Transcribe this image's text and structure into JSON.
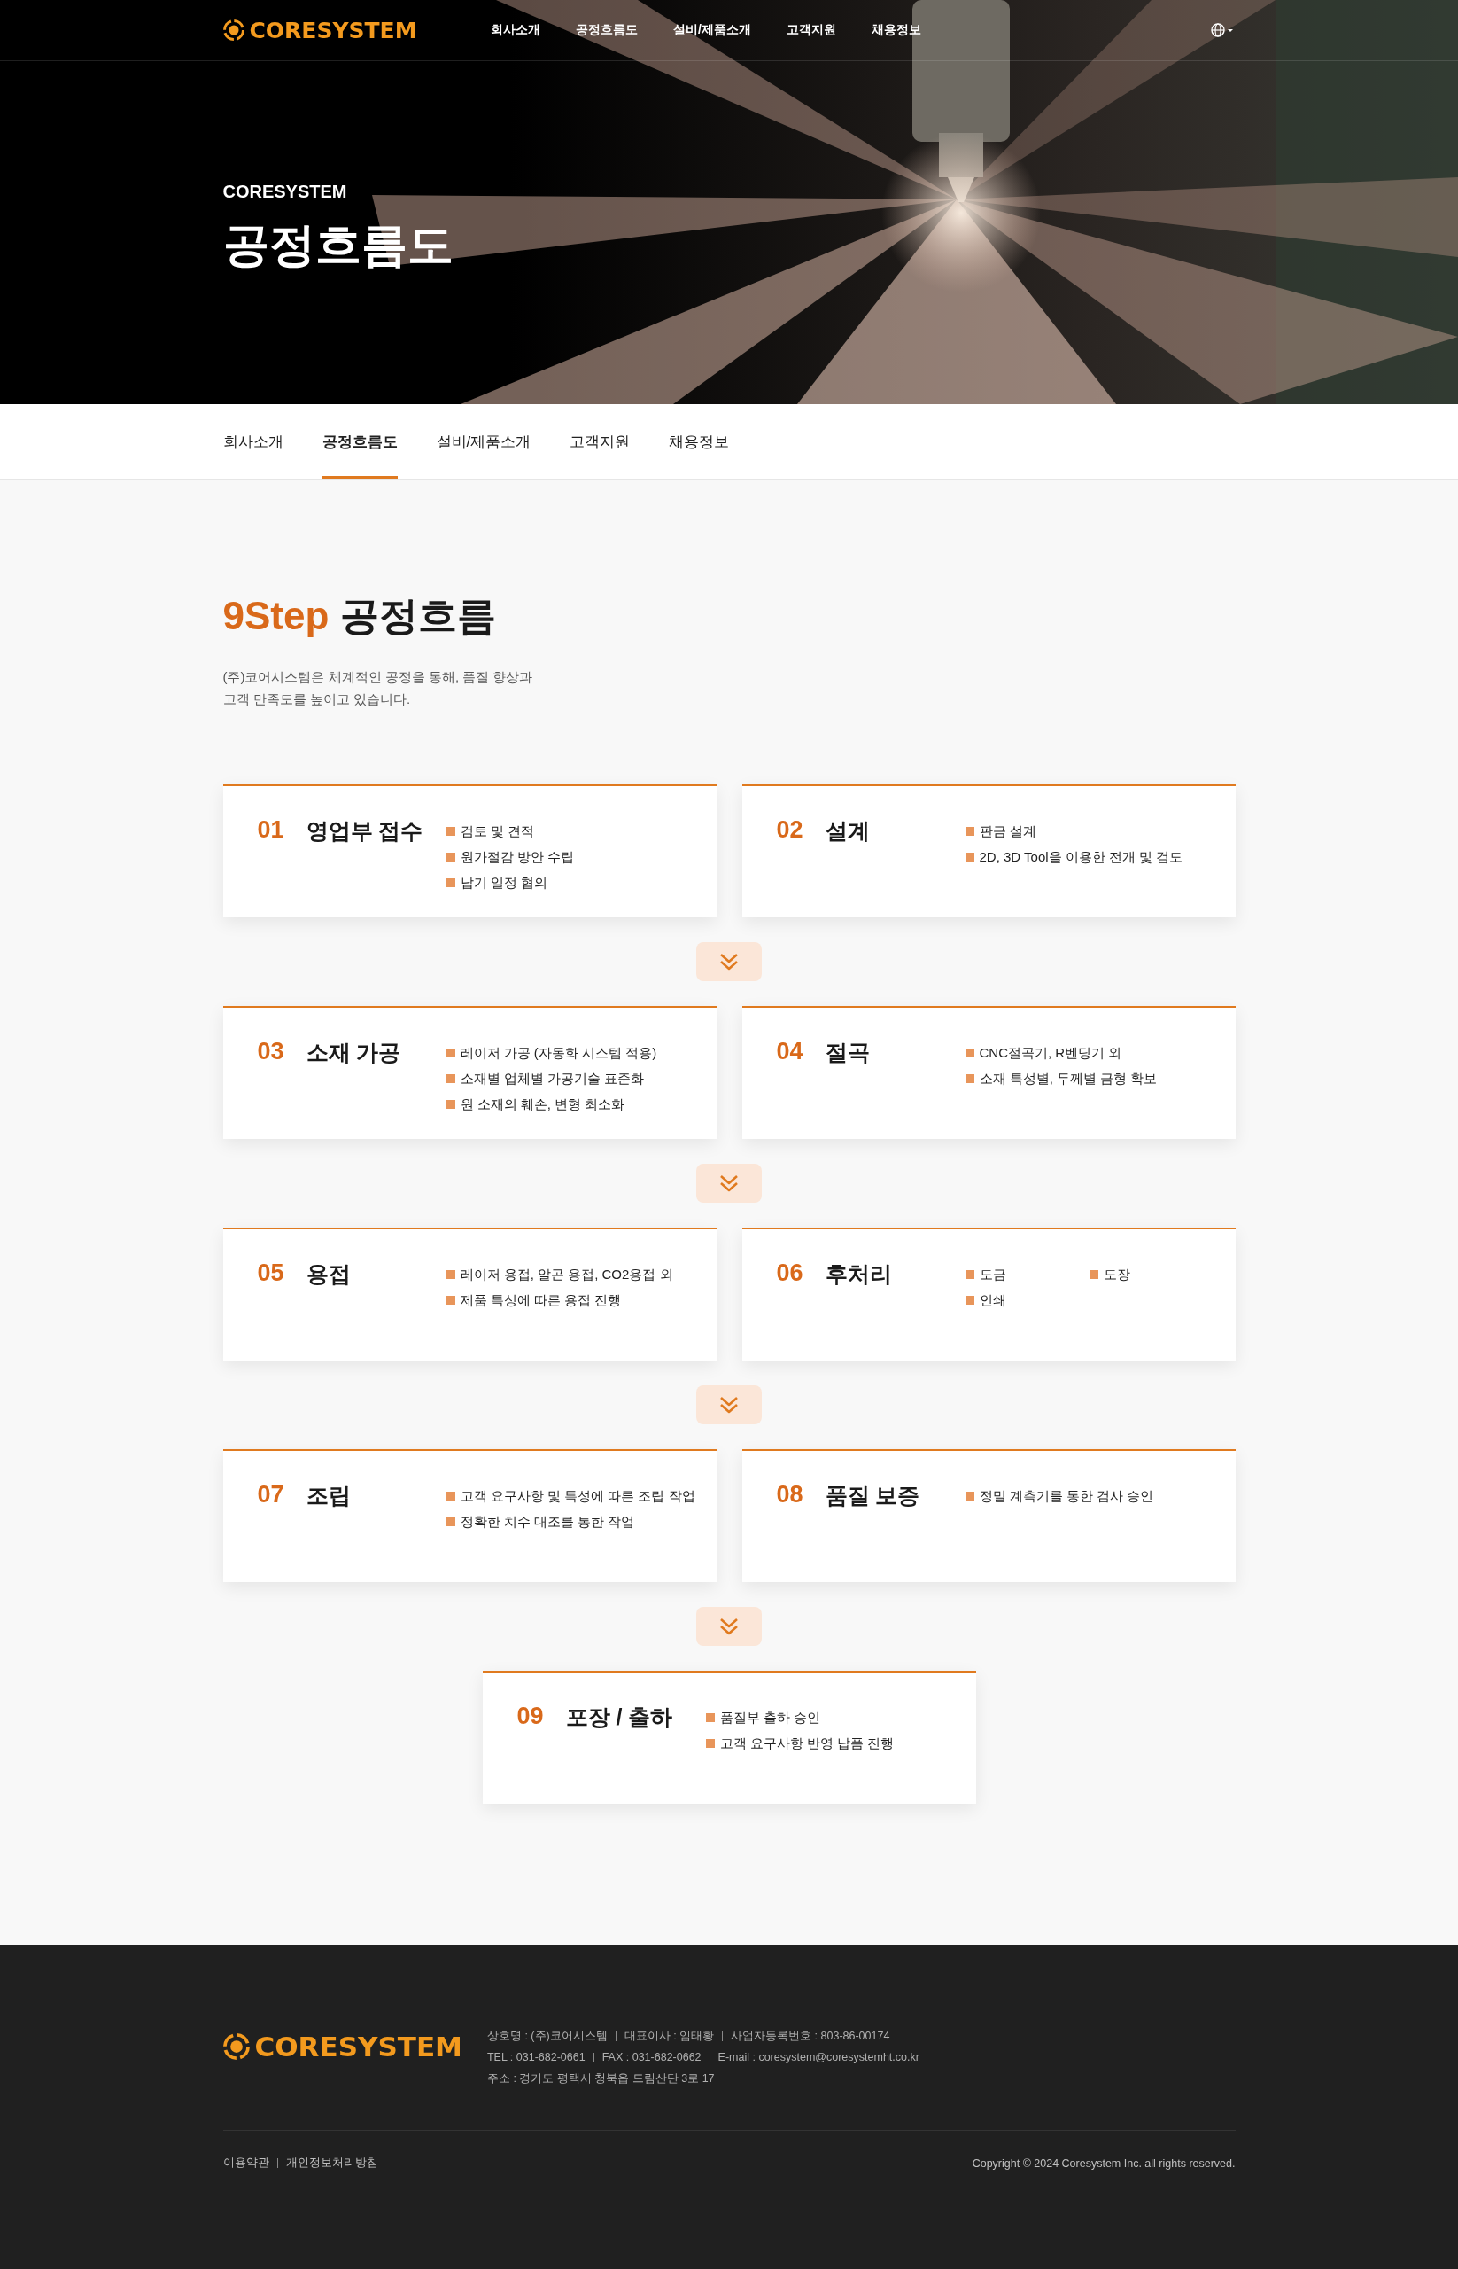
{
  "header": {
    "logo": "CORESYSTEM",
    "nav": [
      "회사소개",
      "공정흐름도",
      "설비/제품소개",
      "고객지원",
      "채용정보"
    ]
  },
  "hero": {
    "subtitle": "CORESYSTEM",
    "title": "공정흐름도"
  },
  "subnav": [
    {
      "label": "회사소개",
      "selected": false
    },
    {
      "label": "공정흐름도",
      "selected": true
    },
    {
      "label": "설비/제품소개",
      "selected": false
    },
    {
      "label": "고객지원",
      "selected": false
    },
    {
      "label": "채용정보",
      "selected": false
    }
  ],
  "section": {
    "title_accent": "9Step",
    "title": "공정흐름",
    "description": [
      "(주)코어시스템은 체계적인 공정을 통해, 품질 향상과",
      "고객 만족도를 높이고 있습니다."
    ]
  },
  "steps": [
    {
      "number": "01",
      "title": "영업부 접수",
      "kind": "list",
      "items": [
        "검토 및 견적",
        "원가절감 방안 수립",
        "납기 일정 협의"
      ]
    },
    {
      "number": "02",
      "title": "설계",
      "kind": "list",
      "items": [
        "판금 설계",
        "2D, 3D Tool을 이용한 전개 및 검도"
      ]
    },
    {
      "number": "03",
      "title": "소재 가공",
      "kind": "list",
      "items": [
        "레이저 가공 (자동화 시스템 적용)",
        "소재별 업체별 가공기술 표준화",
        "원 소재의 훼손, 변형 최소화"
      ]
    },
    {
      "number": "04",
      "title": "절곡",
      "kind": "list",
      "items": [
        "CNC절곡기, R벤딩기 외",
        "소재 특성별, 두께별 금형 확보"
      ]
    },
    {
      "number": "05",
      "title": "용접",
      "kind": "list",
      "items": [
        "레이저 용접, 알곤 용접, CO2용접 외",
        "제품 특성에 따른 용접 진행"
      ]
    },
    {
      "number": "06",
      "title": "후처리",
      "kind": "grid",
      "items": [
        "도금",
        "도장",
        "인쇄"
      ]
    },
    {
      "number": "07",
      "title": "조립",
      "kind": "list",
      "items": [
        "고객 요구사항 및 특성에 따른 조립 작업",
        "정확한 치수 대조를 통한 작업"
      ]
    },
    {
      "number": "08",
      "title": "품질 보증",
      "kind": "list",
      "items": [
        "정밀 계측기를 통한 검사 승인"
      ]
    },
    {
      "number": "09",
      "title": "포장 / 출하",
      "kind": "list",
      "items": [
        "품질부 출하 승인",
        "고객 요구사항 반영 납품 진행"
      ]
    }
  ],
  "footer": {
    "logo": "CORESYSTEM",
    "info": [
      [
        "상호명 : (주)코어시스템",
        "대표이사 : 임태황",
        "사업자등록번호 : 803-86-00174"
      ],
      [
        "TEL : 031-682-0661",
        "FAX : 031-682-0662",
        "E-mail : coresystem@coresystemht.co.kr"
      ],
      [
        "주소 : 경기도 평택시 청북읍 드림산단 3로 17"
      ]
    ],
    "links": [
      "이용약관",
      "개인정보처리방침"
    ],
    "copyright": "Copyright © 2024 Coresystem Inc. all rights reserved."
  }
}
